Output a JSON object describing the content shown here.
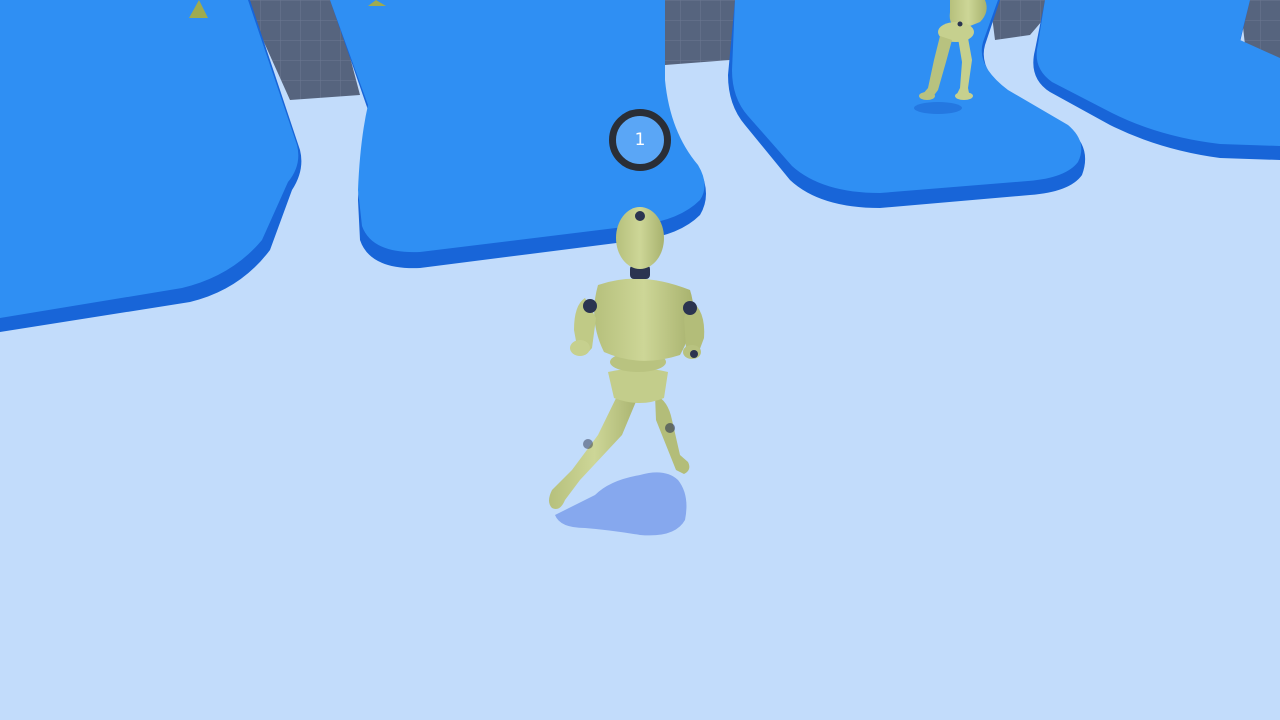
{
  "hud": {
    "player_number": "1"
  },
  "colors": {
    "floor": "#c2dcfb",
    "platform_top": "#2f8ff3",
    "platform_side": "#1865d8",
    "grid_background": "#4a5a78",
    "mannequin_body": "#c6d08e",
    "mannequin_joint": "#2b3450",
    "marker_ring": "#2a2e36"
  }
}
